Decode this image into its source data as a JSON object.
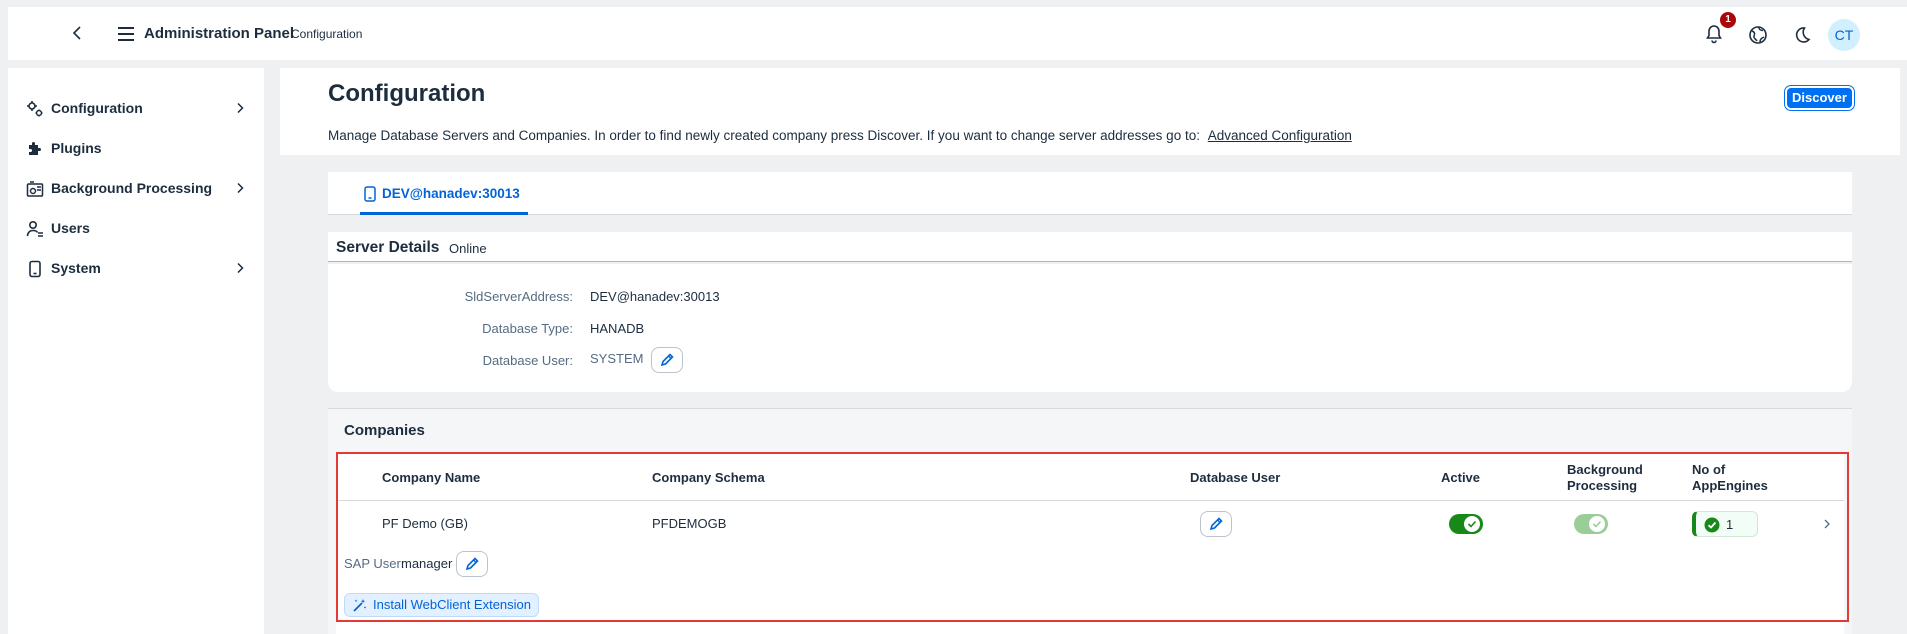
{
  "shell": {
    "title": "Administration Panel",
    "subtitle": "Configuration",
    "notification_count": "1",
    "avatar_initials": "CT"
  },
  "sidenav": {
    "items": [
      {
        "label": "Configuration",
        "icon": "configuration-gears-icon",
        "has_children": true
      },
      {
        "label": "Plugins",
        "icon": "plugins-icon",
        "has_children": false
      },
      {
        "label": "Background Processing",
        "icon": "background-processing-icon",
        "has_children": true
      },
      {
        "label": "Users",
        "icon": "users-icon",
        "has_children": false
      },
      {
        "label": "System",
        "icon": "system-device-icon",
        "has_children": true
      }
    ]
  },
  "page": {
    "title": "Configuration",
    "discover_label": "Discover",
    "description": "Manage Database Servers and Companies. In order to find newly created company press Discover. If you want to change server addresses go to:",
    "advanced_link": "Advanced Configuration"
  },
  "tabs": [
    {
      "label": "DEV@hanadev:30013",
      "selected": true
    }
  ],
  "server": {
    "section_title": "Server Details",
    "status": "Online",
    "fields": [
      {
        "label": "SldServerAddress:",
        "value": "DEV@hanadev:30013"
      },
      {
        "label": "Database Type:",
        "value": "HANADB"
      },
      {
        "label": "Database User:",
        "value": "SYSTEM"
      }
    ]
  },
  "companies": {
    "section_title": "Companies",
    "columns": {
      "company_name": "Company Name",
      "company_schema": "Company Schema",
      "database_user": "Database User",
      "active": "Active",
      "background_processing": "Background Processing",
      "no_of_appengines": "No of AppEngines"
    },
    "rows": [
      {
        "company_name": "PF Demo (GB)",
        "company_schema": "PFDEMOGB",
        "active": true,
        "background_processing": true,
        "background_processing_enabled": false,
        "appengines": "1",
        "sap_user_label": "SAP User:",
        "sap_user": "manager",
        "install_label": "Install WebClient Extension"
      }
    ]
  },
  "colors": {
    "accent": "#0064d9",
    "positive": "#188918",
    "badge": "#aa0808",
    "highlight": "#e53935"
  }
}
